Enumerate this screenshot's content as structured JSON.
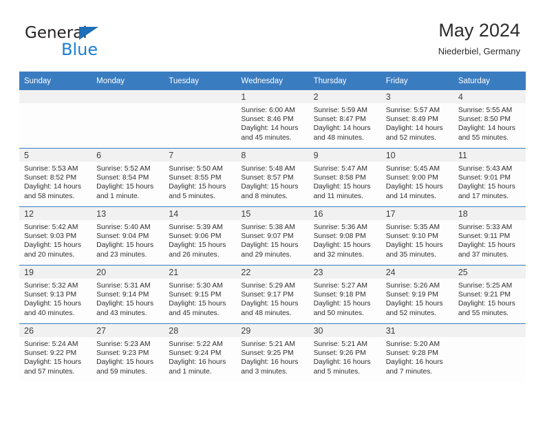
{
  "brand": {
    "name_top": "General",
    "name_bottom": "Blue",
    "accent_color": "#1b7fd4",
    "triangle_color": "#1d6fb8"
  },
  "header": {
    "title": "May 2024",
    "location": "Niederbiel, Germany"
  },
  "theme": {
    "header_bg": "#3a7cc0",
    "daynum_bg": "#f1f1f1",
    "cell_bg": "#fdfdfd",
    "row_rule": "#3a7cc0"
  },
  "weekday_headers": [
    "Sunday",
    "Monday",
    "Tuesday",
    "Wednesday",
    "Thursday",
    "Friday",
    "Saturday"
  ],
  "weeks": [
    [
      {
        "day": "",
        "empty": true,
        "sunrise": "",
        "sunset": "",
        "daylight_1": "",
        "daylight_2": ""
      },
      {
        "day": "",
        "empty": true,
        "sunrise": "",
        "sunset": "",
        "daylight_1": "",
        "daylight_2": ""
      },
      {
        "day": "",
        "empty": true,
        "sunrise": "",
        "sunset": "",
        "daylight_1": "",
        "daylight_2": ""
      },
      {
        "day": "1",
        "empty": false,
        "sunrise": "Sunrise: 6:00 AM",
        "sunset": "Sunset: 8:46 PM",
        "daylight_1": "Daylight: 14 hours",
        "daylight_2": "and 45 minutes."
      },
      {
        "day": "2",
        "empty": false,
        "sunrise": "Sunrise: 5:59 AM",
        "sunset": "Sunset: 8:47 PM",
        "daylight_1": "Daylight: 14 hours",
        "daylight_2": "and 48 minutes."
      },
      {
        "day": "3",
        "empty": false,
        "sunrise": "Sunrise: 5:57 AM",
        "sunset": "Sunset: 8:49 PM",
        "daylight_1": "Daylight: 14 hours",
        "daylight_2": "and 52 minutes."
      },
      {
        "day": "4",
        "empty": false,
        "sunrise": "Sunrise: 5:55 AM",
        "sunset": "Sunset: 8:50 PM",
        "daylight_1": "Daylight: 14 hours",
        "daylight_2": "and 55 minutes."
      }
    ],
    [
      {
        "day": "5",
        "empty": false,
        "sunrise": "Sunrise: 5:53 AM",
        "sunset": "Sunset: 8:52 PM",
        "daylight_1": "Daylight: 14 hours",
        "daylight_2": "and 58 minutes."
      },
      {
        "day": "6",
        "empty": false,
        "sunrise": "Sunrise: 5:52 AM",
        "sunset": "Sunset: 8:54 PM",
        "daylight_1": "Daylight: 15 hours",
        "daylight_2": "and 1 minute."
      },
      {
        "day": "7",
        "empty": false,
        "sunrise": "Sunrise: 5:50 AM",
        "sunset": "Sunset: 8:55 PM",
        "daylight_1": "Daylight: 15 hours",
        "daylight_2": "and 5 minutes."
      },
      {
        "day": "8",
        "empty": false,
        "sunrise": "Sunrise: 5:48 AM",
        "sunset": "Sunset: 8:57 PM",
        "daylight_1": "Daylight: 15 hours",
        "daylight_2": "and 8 minutes."
      },
      {
        "day": "9",
        "empty": false,
        "sunrise": "Sunrise: 5:47 AM",
        "sunset": "Sunset: 8:58 PM",
        "daylight_1": "Daylight: 15 hours",
        "daylight_2": "and 11 minutes."
      },
      {
        "day": "10",
        "empty": false,
        "sunrise": "Sunrise: 5:45 AM",
        "sunset": "Sunset: 9:00 PM",
        "daylight_1": "Daylight: 15 hours",
        "daylight_2": "and 14 minutes."
      },
      {
        "day": "11",
        "empty": false,
        "sunrise": "Sunrise: 5:43 AM",
        "sunset": "Sunset: 9:01 PM",
        "daylight_1": "Daylight: 15 hours",
        "daylight_2": "and 17 minutes."
      }
    ],
    [
      {
        "day": "12",
        "empty": false,
        "sunrise": "Sunrise: 5:42 AM",
        "sunset": "Sunset: 9:03 PM",
        "daylight_1": "Daylight: 15 hours",
        "daylight_2": "and 20 minutes."
      },
      {
        "day": "13",
        "empty": false,
        "sunrise": "Sunrise: 5:40 AM",
        "sunset": "Sunset: 9:04 PM",
        "daylight_1": "Daylight: 15 hours",
        "daylight_2": "and 23 minutes."
      },
      {
        "day": "14",
        "empty": false,
        "sunrise": "Sunrise: 5:39 AM",
        "sunset": "Sunset: 9:06 PM",
        "daylight_1": "Daylight: 15 hours",
        "daylight_2": "and 26 minutes."
      },
      {
        "day": "15",
        "empty": false,
        "sunrise": "Sunrise: 5:38 AM",
        "sunset": "Sunset: 9:07 PM",
        "daylight_1": "Daylight: 15 hours",
        "daylight_2": "and 29 minutes."
      },
      {
        "day": "16",
        "empty": false,
        "sunrise": "Sunrise: 5:36 AM",
        "sunset": "Sunset: 9:08 PM",
        "daylight_1": "Daylight: 15 hours",
        "daylight_2": "and 32 minutes."
      },
      {
        "day": "17",
        "empty": false,
        "sunrise": "Sunrise: 5:35 AM",
        "sunset": "Sunset: 9:10 PM",
        "daylight_1": "Daylight: 15 hours",
        "daylight_2": "and 35 minutes."
      },
      {
        "day": "18",
        "empty": false,
        "sunrise": "Sunrise: 5:33 AM",
        "sunset": "Sunset: 9:11 PM",
        "daylight_1": "Daylight: 15 hours",
        "daylight_2": "and 37 minutes."
      }
    ],
    [
      {
        "day": "19",
        "empty": false,
        "sunrise": "Sunrise: 5:32 AM",
        "sunset": "Sunset: 9:13 PM",
        "daylight_1": "Daylight: 15 hours",
        "daylight_2": "and 40 minutes."
      },
      {
        "day": "20",
        "empty": false,
        "sunrise": "Sunrise: 5:31 AM",
        "sunset": "Sunset: 9:14 PM",
        "daylight_1": "Daylight: 15 hours",
        "daylight_2": "and 43 minutes."
      },
      {
        "day": "21",
        "empty": false,
        "sunrise": "Sunrise: 5:30 AM",
        "sunset": "Sunset: 9:15 PM",
        "daylight_1": "Daylight: 15 hours",
        "daylight_2": "and 45 minutes."
      },
      {
        "day": "22",
        "empty": false,
        "sunrise": "Sunrise: 5:29 AM",
        "sunset": "Sunset: 9:17 PM",
        "daylight_1": "Daylight: 15 hours",
        "daylight_2": "and 48 minutes."
      },
      {
        "day": "23",
        "empty": false,
        "sunrise": "Sunrise: 5:27 AM",
        "sunset": "Sunset: 9:18 PM",
        "daylight_1": "Daylight: 15 hours",
        "daylight_2": "and 50 minutes."
      },
      {
        "day": "24",
        "empty": false,
        "sunrise": "Sunrise: 5:26 AM",
        "sunset": "Sunset: 9:19 PM",
        "daylight_1": "Daylight: 15 hours",
        "daylight_2": "and 52 minutes."
      },
      {
        "day": "25",
        "empty": false,
        "sunrise": "Sunrise: 5:25 AM",
        "sunset": "Sunset: 9:21 PM",
        "daylight_1": "Daylight: 15 hours",
        "daylight_2": "and 55 minutes."
      }
    ],
    [
      {
        "day": "26",
        "empty": false,
        "sunrise": "Sunrise: 5:24 AM",
        "sunset": "Sunset: 9:22 PM",
        "daylight_1": "Daylight: 15 hours",
        "daylight_2": "and 57 minutes."
      },
      {
        "day": "27",
        "empty": false,
        "sunrise": "Sunrise: 5:23 AM",
        "sunset": "Sunset: 9:23 PM",
        "daylight_1": "Daylight: 15 hours",
        "daylight_2": "and 59 minutes."
      },
      {
        "day": "28",
        "empty": false,
        "sunrise": "Sunrise: 5:22 AM",
        "sunset": "Sunset: 9:24 PM",
        "daylight_1": "Daylight: 16 hours",
        "daylight_2": "and 1 minute."
      },
      {
        "day": "29",
        "empty": false,
        "sunrise": "Sunrise: 5:21 AM",
        "sunset": "Sunset: 9:25 PM",
        "daylight_1": "Daylight: 16 hours",
        "daylight_2": "and 3 minutes."
      },
      {
        "day": "30",
        "empty": false,
        "sunrise": "Sunrise: 5:21 AM",
        "sunset": "Sunset: 9:26 PM",
        "daylight_1": "Daylight: 16 hours",
        "daylight_2": "and 5 minutes."
      },
      {
        "day": "31",
        "empty": false,
        "sunrise": "Sunrise: 5:20 AM",
        "sunset": "Sunset: 9:28 PM",
        "daylight_1": "Daylight: 16 hours",
        "daylight_2": "and 7 minutes."
      },
      {
        "day": "",
        "empty": true,
        "sunrise": "",
        "sunset": "",
        "daylight_1": "",
        "daylight_2": ""
      }
    ]
  ]
}
